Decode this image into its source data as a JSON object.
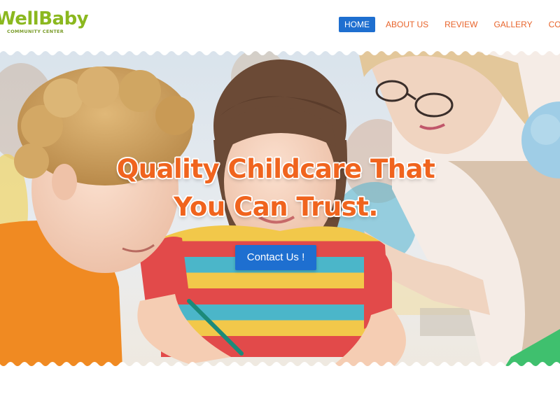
{
  "brand": {
    "name": "WellBaby",
    "tagline": "COMMUNITY CENTER",
    "primary_color": "#1e6fd0",
    "accent_color": "#e8642b",
    "logo_color": "#8bb81f"
  },
  "nav": {
    "items": [
      {
        "label": "HOME",
        "active": true
      },
      {
        "label": "ABOUT US",
        "active": false
      },
      {
        "label": "REVIEW",
        "active": false
      },
      {
        "label": "GALLERY",
        "active": false
      },
      {
        "label": "CONTA",
        "active": false
      }
    ]
  },
  "hero": {
    "headline_line1": "Quality Childcare That",
    "headline_line2": "You Can Trust.",
    "cta_label": "Contact Us !",
    "image_icon": "children-with-teacher-photo"
  }
}
